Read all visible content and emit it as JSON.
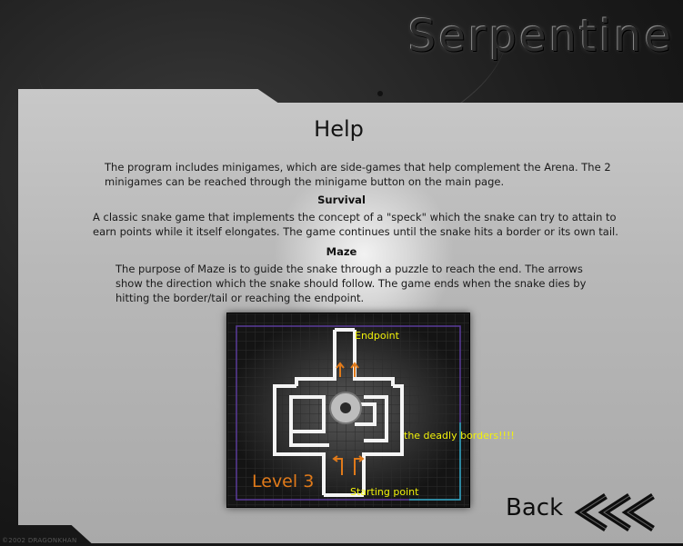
{
  "game": {
    "title": "Serpentine"
  },
  "help": {
    "title": "Help",
    "intro": "The program includes minigames, which are side-games that help complement the Arena. The 2 minigames can be reached through the minigame button on the main page.",
    "survival": {
      "heading": "Survival",
      "text": "A classic snake game that implements the concept of a \"speck\" which the snake can try to attain to earn points while it itself elongates. The game continues until the snake hits a border or its own tail."
    },
    "maze": {
      "heading": "Maze",
      "text": "The purpose of Maze is to guide the snake through a puzzle to reach the end. The arrows show the direction which the snake should follow. The game ends when the snake dies by hitting the border/tail or reaching the endpoint."
    }
  },
  "maze_preview": {
    "level_label": "Level 3",
    "endpoint_label": "Endpoint",
    "borders_label": "the deadly borders!!!!",
    "start_label": "Starting point",
    "annotation_color": "#f2f20a",
    "level_color": "#e07a1a"
  },
  "navigation": {
    "back_label": "Back"
  },
  "footer": {
    "copyright": "©2002 DRAGONKHAN"
  }
}
